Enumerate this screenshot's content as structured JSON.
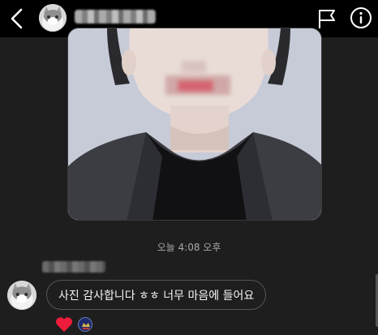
{
  "header": {
    "back_icon": "chevron-left-icon",
    "flag_icon": "flag-icon",
    "info_icon": "info-icon"
  },
  "chat": {
    "timestamp": "오늘 4:08 오후",
    "message": {
      "text": "사진 감사합니다 ㅎㅎ 너무 마음에 들어요",
      "reactions": [
        "heart-reaction",
        "avatar-reaction"
      ]
    }
  },
  "colors": {
    "background": "#1e1e1e",
    "header": "#000000",
    "heart": "#ed1c3b",
    "bubble_border": "#555555"
  }
}
